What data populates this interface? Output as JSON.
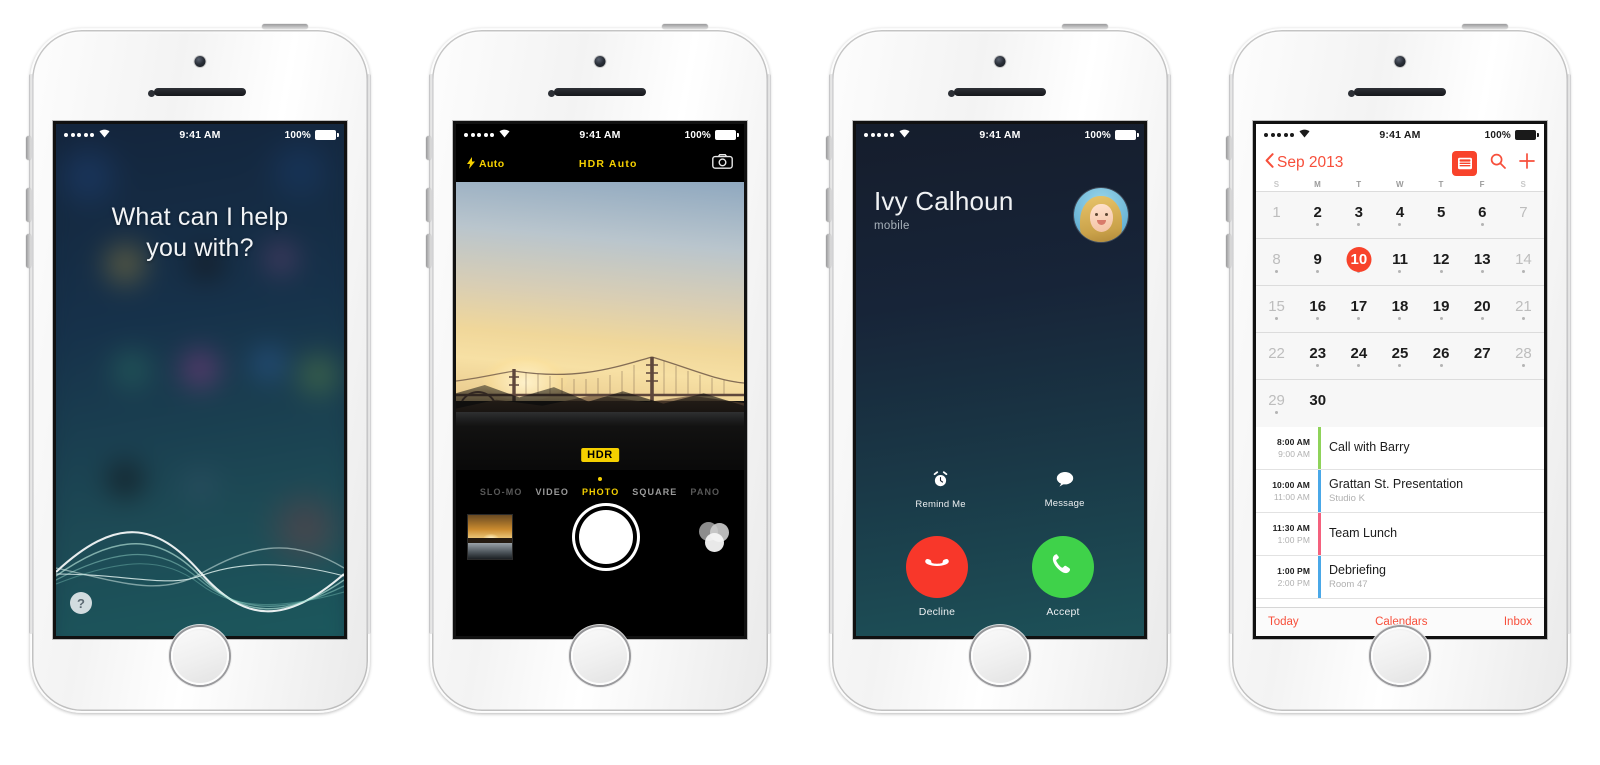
{
  "phones": [
    {
      "id": "siri",
      "status_bar": {
        "carrier_dots": 5,
        "wifi_icon": "wifi-icon",
        "time": "9:41 AM",
        "battery_percent": "100%",
        "battery_icon": "battery-full-icon"
      },
      "siri": {
        "prompt_line1": "What can I help",
        "prompt_line2": "you with?",
        "help_button_label": "?",
        "help_icon": "question-mark-icon",
        "waveform_icon": "siri-waveform"
      }
    },
    {
      "id": "camera",
      "status_bar": {
        "carrier_dots": 5,
        "wifi_icon": "wifi-icon",
        "time": "9:41 AM",
        "battery_percent": "100%",
        "battery_icon": "battery-full-icon"
      },
      "camera": {
        "flash_label": "Auto",
        "flash_icon": "lightning-bolt-icon",
        "hdr_label": "HDR Auto",
        "flip_icon": "camera-flip-icon",
        "hdr_badge": "HDR",
        "modes": [
          {
            "label": "SLO-MO",
            "state": "dim"
          },
          {
            "label": "VIDEO",
            "state": "normal"
          },
          {
            "label": "PHOTO",
            "state": "selected"
          },
          {
            "label": "SQUARE",
            "state": "normal"
          },
          {
            "label": "PANO",
            "state": "dim"
          }
        ],
        "thumbnail_name": "last-photo-thumbnail",
        "shutter_name": "shutter-button",
        "filter_name": "filter-button"
      }
    },
    {
      "id": "call",
      "status_bar": {
        "carrier_dots": 5,
        "wifi_icon": "wifi-icon",
        "time": "9:41 AM",
        "battery_percent": "100%",
        "battery_icon": "battery-full-icon"
      },
      "call": {
        "caller_name": "Ivy Calhoun",
        "caller_label": "mobile",
        "avatar_name": "caller-avatar",
        "remind_label": "Remind Me",
        "remind_icon": "alarm-clock-icon",
        "message_label": "Message",
        "message_icon": "speech-bubble-icon",
        "decline_label": "Decline",
        "decline_icon": "phone-down-icon",
        "accept_label": "Accept",
        "accept_icon": "phone-icon",
        "decline_color": "#f8372a",
        "accept_color": "#3fd24a"
      }
    },
    {
      "id": "calendar",
      "status_bar": {
        "carrier_dots": 5,
        "wifi_icon": "wifi-icon",
        "time": "9:41 AM",
        "battery_percent": "100%",
        "battery_icon": "battery-full-icon"
      },
      "calendar": {
        "month_title": "Sep 2013",
        "back_icon": "chevron-left-icon",
        "list_view_icon": "list-view-icon",
        "search_icon": "search-icon",
        "add_icon": "plus-icon",
        "accent_color": "#f74f3b",
        "day_headers": [
          "S",
          "M",
          "T",
          "W",
          "T",
          "F",
          "S"
        ],
        "weeks": [
          [
            {
              "n": "1",
              "muted": true,
              "dot": false
            },
            {
              "n": "2",
              "muted": false,
              "dot": true
            },
            {
              "n": "3",
              "muted": false,
              "dot": true
            },
            {
              "n": "4",
              "muted": false,
              "dot": true
            },
            {
              "n": "5",
              "muted": false,
              "dot": false
            },
            {
              "n": "6",
              "muted": false,
              "dot": true
            },
            {
              "n": "7",
              "muted": true,
              "dot": false
            }
          ],
          [
            {
              "n": "8",
              "muted": true,
              "dot": true
            },
            {
              "n": "9",
              "muted": false,
              "dot": true
            },
            {
              "n": "10",
              "muted": false,
              "dot": true,
              "selected": true
            },
            {
              "n": "11",
              "muted": false,
              "dot": true
            },
            {
              "n": "12",
              "muted": false,
              "dot": true
            },
            {
              "n": "13",
              "muted": false,
              "dot": true
            },
            {
              "n": "14",
              "muted": true,
              "dot": true
            }
          ],
          [
            {
              "n": "15",
              "muted": true,
              "dot": true
            },
            {
              "n": "16",
              "muted": false,
              "dot": true
            },
            {
              "n": "17",
              "muted": false,
              "dot": true
            },
            {
              "n": "18",
              "muted": false,
              "dot": true
            },
            {
              "n": "19",
              "muted": false,
              "dot": true
            },
            {
              "n": "20",
              "muted": false,
              "dot": true
            },
            {
              "n": "21",
              "muted": true,
              "dot": true
            }
          ],
          [
            {
              "n": "22",
              "muted": true,
              "dot": false
            },
            {
              "n": "23",
              "muted": false,
              "dot": true
            },
            {
              "n": "24",
              "muted": false,
              "dot": true
            },
            {
              "n": "25",
              "muted": false,
              "dot": true
            },
            {
              "n": "26",
              "muted": false,
              "dot": true
            },
            {
              "n": "27",
              "muted": false,
              "dot": false
            },
            {
              "n": "28",
              "muted": true,
              "dot": true
            }
          ],
          [
            {
              "n": "29",
              "muted": true,
              "dot": true
            },
            {
              "n": "30",
              "muted": false,
              "dot": false
            },
            {
              "n": "",
              "muted": true,
              "dot": false
            },
            {
              "n": "",
              "muted": true,
              "dot": false
            },
            {
              "n": "",
              "muted": true,
              "dot": false
            },
            {
              "n": "",
              "muted": true,
              "dot": false
            },
            {
              "n": "",
              "muted": true,
              "dot": false
            }
          ]
        ],
        "events": [
          {
            "start": "8:00 AM",
            "end": "9:00 AM",
            "title": "Call with Barry",
            "location": "",
            "color": "#8fd35a"
          },
          {
            "start": "10:00 AM",
            "end": "11:00 AM",
            "title": "Grattan St. Presentation",
            "location": "Studio K",
            "color": "#4aa8e8"
          },
          {
            "start": "11:30 AM",
            "end": "1:00 PM",
            "title": "Team Lunch",
            "location": "",
            "color": "#f4617e"
          },
          {
            "start": "1:00 PM",
            "end": "2:00 PM",
            "title": "Debriefing",
            "location": "Room 47",
            "color": "#4aa8e8"
          }
        ],
        "tabs": [
          {
            "label": "Today"
          },
          {
            "label": "Calendars"
          },
          {
            "label": "Inbox"
          }
        ]
      }
    }
  ]
}
